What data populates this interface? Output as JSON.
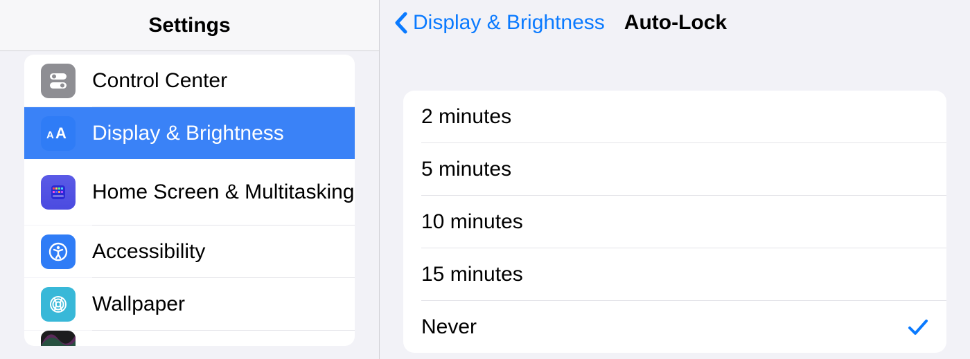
{
  "sidebar": {
    "title": "Settings",
    "items": [
      {
        "label": "Control Center"
      },
      {
        "label": "Display & Brightness"
      },
      {
        "label": "Home Screen & Multitasking"
      },
      {
        "label": "Accessibility"
      },
      {
        "label": "Wallpaper"
      }
    ],
    "selectedIndex": 1
  },
  "detail": {
    "back_label": "Display & Brightness",
    "title": "Auto-Lock",
    "options": [
      {
        "label": "2 minutes"
      },
      {
        "label": "5 minutes"
      },
      {
        "label": "10 minutes"
      },
      {
        "label": "15 minutes"
      },
      {
        "label": "Never"
      }
    ],
    "selectedIndex": 4
  },
  "colors": {
    "accent": "#0a7aff",
    "selected_bg": "#3a82f7"
  }
}
